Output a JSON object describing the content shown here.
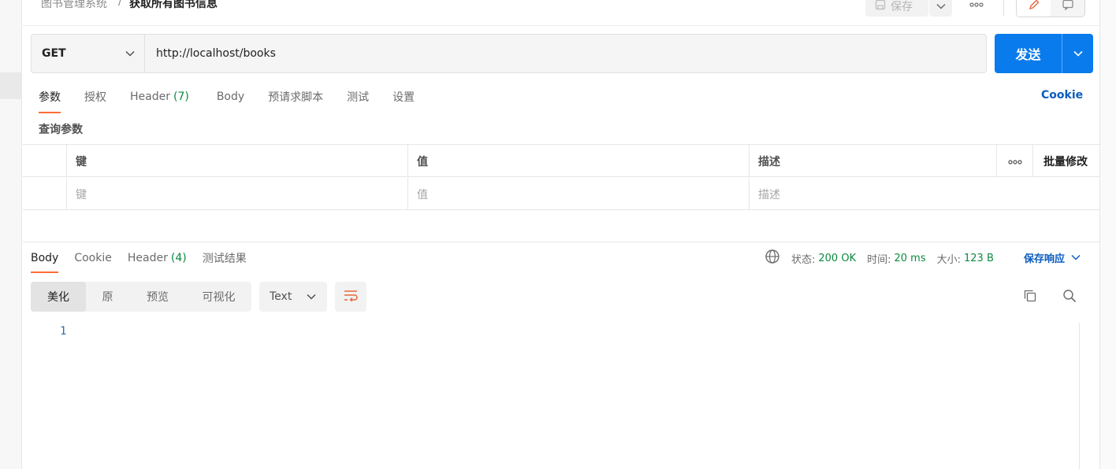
{
  "breadcrumb": {
    "parent": "图书管理系统",
    "separator": "/",
    "current": "获取所有图书信息"
  },
  "toolbar": {
    "save_label": "保存"
  },
  "request": {
    "method": "GET",
    "url": "http://localhost/books",
    "send_label": "发送"
  },
  "request_tabs": [
    {
      "label": "参数",
      "count": "",
      "active": true
    },
    {
      "label": "授权",
      "count": ""
    },
    {
      "label": "Header",
      "count": "(7)"
    },
    {
      "label": "Body",
      "count": ""
    },
    {
      "label": "预请求脚本",
      "count": ""
    },
    {
      "label": "测试",
      "count": ""
    },
    {
      "label": "设置",
      "count": ""
    }
  ],
  "cookie_link": "Cookie",
  "params": {
    "title": "查询参数",
    "headers": {
      "key": "键",
      "value": "值",
      "description": "描述",
      "bulk_edit": "批量修改"
    },
    "placeholders": {
      "key": "键",
      "value": "值",
      "description": "描述"
    }
  },
  "response": {
    "tabs": [
      {
        "label": "Body",
        "count": "",
        "active": true
      },
      {
        "label": "Cookie",
        "count": ""
      },
      {
        "label": "Header",
        "count": "(4)"
      },
      {
        "label": "测试结果",
        "count": ""
      }
    ],
    "status_label": "状态:",
    "status_value": "200 OK",
    "time_label": "时间:",
    "time_value": "20 ms",
    "size_label": "大小:",
    "size_value": "123 B",
    "save_label": "保存响应",
    "formats": [
      "美化",
      "原",
      "预览",
      "可视化"
    ],
    "language": "Text",
    "line_numbers": [
      "1"
    ]
  },
  "colors": {
    "accent": "#ff6c37",
    "send_button": "#097bed",
    "link": "#0b5cbf",
    "success": "#0c8a3f"
  }
}
